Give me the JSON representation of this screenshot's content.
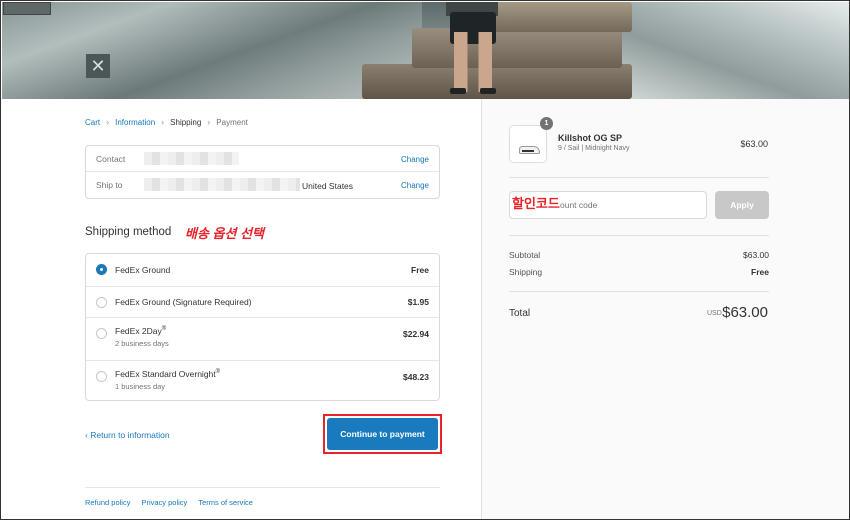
{
  "breadcrumb": {
    "cart": "Cart",
    "information": "Information",
    "shipping": "Shipping",
    "payment": "Payment"
  },
  "contact_box": {
    "contact_label": "Contact",
    "ship_to_label": "Ship to",
    "ship_to_value": "United States",
    "change_label": "Change"
  },
  "shipping_method": {
    "heading": "Shipping method",
    "annotation": "배송 옵션 선택",
    "selected_index": 0,
    "rates": [
      {
        "name": "FedEx Ground",
        "sup": "",
        "sub": "",
        "price": "Free"
      },
      {
        "name": "FedEx Ground (Signature Required)",
        "sup": "",
        "sub": "",
        "price": "$1.95"
      },
      {
        "name": "FedEx 2Day",
        "sup": "®",
        "sub": "2 business days",
        "price": "$22.94"
      },
      {
        "name": "FedEx Standard Overnight",
        "sup": "®",
        "sub": "1 business day",
        "price": "$48.23"
      }
    ]
  },
  "actions": {
    "return_label": "Return to information",
    "return_icon": "chevron-left-icon",
    "continue_label": "Continue to payment",
    "highlight_color": "#e8232a"
  },
  "footer": {
    "refund": "Refund policy",
    "privacy": "Privacy policy",
    "terms": "Terms of service"
  },
  "summary": {
    "product": {
      "quantity": "1",
      "name": "Killshot OG SP",
      "variant": "9 / Sail | Midnight Navy",
      "price": "$63.00"
    },
    "discount": {
      "placeholder": "ount code",
      "annotation": "할인코드",
      "apply_label": "Apply"
    },
    "subtotal_label": "Subtotal",
    "subtotal_value": "$63.00",
    "shipping_label": "Shipping",
    "shipping_value": "Free",
    "total_label": "Total",
    "total_currency": "USD",
    "total_value": "$63.00"
  },
  "hero": {
    "close_icon": "close-icon"
  },
  "colors": {
    "link": "#1878b9",
    "primary_button": "#197bbd",
    "annotation": "#e8232a"
  }
}
